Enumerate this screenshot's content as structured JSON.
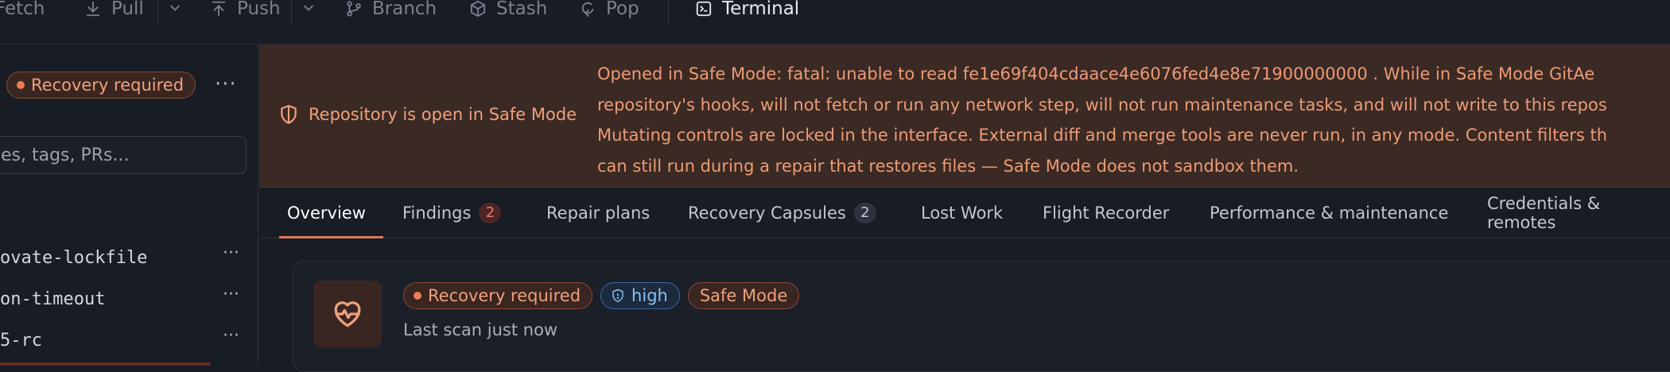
{
  "toolbar": {
    "fetch": "Fetch",
    "pull": "Pull",
    "push": "Push",
    "branch": "Branch",
    "stash": "Stash",
    "pop": "Pop",
    "terminal": "Terminal"
  },
  "sidebar": {
    "status_badge": "Recovery required",
    "search_placeholder": "es, tags, PRs...",
    "branches": [
      "ovate-lockfile",
      "on-timeout",
      "5-rc"
    ]
  },
  "banner": {
    "title": "Repository is open in Safe Mode",
    "lines": [
      "Opened in Safe Mode: fatal: unable to read fe1e69f404cdaace4e6076fed4e8e71900000000 . While in Safe Mode GitAe",
      "repository's hooks, will not fetch or run any network step, will not run maintenance tasks, and will not write to this repos",
      "Mutating controls are locked in the interface. External diff and merge tools are never run, in any mode. Content filters th",
      "can still run during a repair that restores files — Safe Mode does not sandbox them."
    ]
  },
  "tabs": [
    {
      "label": "Overview",
      "count": null
    },
    {
      "label": "Findings",
      "count": "2"
    },
    {
      "label": "Repair plans",
      "count": null
    },
    {
      "label": "Recovery Capsules",
      "count": "2"
    },
    {
      "label": "Lost Work",
      "count": null
    },
    {
      "label": "Flight Recorder",
      "count": null
    },
    {
      "label": "Performance & maintenance",
      "count": null
    },
    {
      "label": "Credentials & remotes",
      "count": null
    }
  ],
  "card": {
    "status_badge": "Recovery required",
    "severity_badge": "high",
    "mode_badge": "Safe Mode",
    "subtitle": "Last scan just now"
  },
  "colors": {
    "accent": "#e07850",
    "banner_bg": "#3a2a23",
    "banner_text": "#ee9a76",
    "severity_blue": "#8cc0f2"
  }
}
